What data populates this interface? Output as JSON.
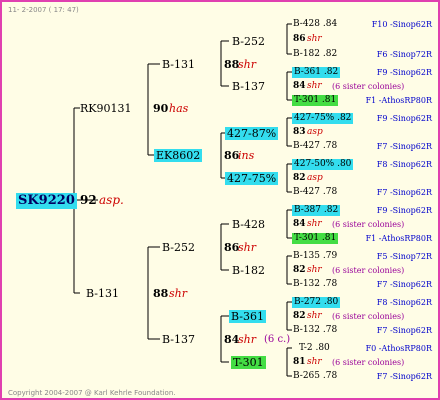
{
  "header": {
    "date": "11- 2-2007 ( 17: 47)"
  },
  "footer": {
    "copyright": "Copyright 2004-2007 @ Karl Kehrle Foundation."
  },
  "root": {
    "id": "SK9220",
    "gen": "92",
    "name": "asp."
  },
  "gen1": [
    {
      "id": "RK90131",
      "gen": "90",
      "name": "has"
    },
    {
      "id": "B-131",
      "gen": "88",
      "name": "shr"
    }
  ],
  "gen2": [
    {
      "id": "B-131",
      "gen": "88",
      "name": "shr"
    },
    {
      "id": "EK8602",
      "gen": "86",
      "name": "ins"
    },
    {
      "id": "B-252",
      "gen": "86",
      "name": "shr"
    },
    {
      "id": "B-137",
      "gen": "84",
      "name": "shr",
      "note": "(6 c.)"
    }
  ],
  "gen3": [
    "B-252",
    "B-137",
    "427-87%",
    "427-75%",
    "B-428",
    "B-182",
    "B-361",
    "T-301"
  ],
  "gen4": [
    {
      "line1": "B-428 .84",
      "gen": "86",
      "name": "shr",
      "line3": "B-182 .82",
      "r1": "F10 -Sinop62R",
      "r3": "F6 -Sinop72R"
    },
    {
      "line1": "B-361 .82",
      "gen": "84",
      "name": "shr",
      "sis": "(6 sister colonies)",
      "line3": "T-301 .81",
      "r1": "F9 -Sinop62R",
      "r3": "F1 -AthosRP80R"
    },
    {
      "line1": "427-75% .82",
      "gen": "83",
      "name": "asp",
      "line3": "B-427 .78",
      "r1": "F9 -Sinop62R",
      "r3": "F7 -Sinop62R"
    },
    {
      "line1": "427-50% .80",
      "gen": "82",
      "name": "asp",
      "line3": "B-427 .78",
      "r1": "F8 -Sinop62R",
      "r3": "F7 -Sinop62R"
    },
    {
      "line1": "B-387 .82",
      "gen": "84",
      "name": "shr",
      "sis": "(6 sister colonies)",
      "line3": "T-301 .81",
      "r1": "F9 -Sinop62R",
      "r3": "F1 -AthosRP80R"
    },
    {
      "line1": "B-135 .79",
      "gen": "82",
      "name": "shr",
      "sis": "(6 sister colonies)",
      "line3": "B-132 .78",
      "r1": "F5 -Sinop72R",
      "r3": "F7 -Sinop62R"
    },
    {
      "line1": "B-272 .80",
      "gen": "82",
      "name": "shr",
      "sis": "(6 sister colonies)",
      "line3": "B-132 .78",
      "r1": "F8 -Sinop62R",
      "r3": "F7 -Sinop62R"
    },
    {
      "line1": "T-2 .80",
      "gen": "81",
      "name": "shr",
      "sis": "(6 sister colonies)",
      "line3": "B-265 .78",
      "r1": "F0 -AthosRP80R",
      "r3": "F7 -Sinop62R"
    }
  ]
}
